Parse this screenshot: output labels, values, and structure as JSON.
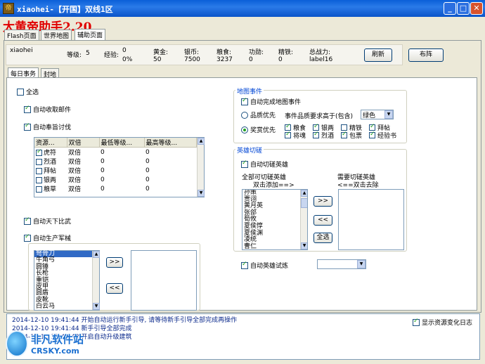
{
  "window": {
    "title": "xiaohei-【开国】双线1区",
    "icon": "app-icon"
  },
  "app_title": "大黄帝助手2.20",
  "tabs": [
    "Flash页面",
    "世界地图",
    "辅助页面"
  ],
  "info": {
    "player": "xiaohei",
    "level_label": "等级:",
    "level": "5",
    "exp_label": "经验:",
    "exp": "0",
    "exp_pct": "0%",
    "gold_label": "黄金:",
    "gold": "50",
    "silver_label": "银币:",
    "silver": "7500",
    "food_label": "粮食:",
    "food": "3237",
    "merit_label": "功勋:",
    "merit": "0",
    "iron_label": "精铁:",
    "iron": "0",
    "power_label": "总战力:",
    "power": "label16"
  },
  "buttons": {
    "refresh": "刷新",
    "formation": "布阵",
    "add": ">>",
    "remove": "<<",
    "select_all": "全选",
    "add2": ">>",
    "remove2": "<<"
  },
  "subtabs": [
    "每日事务",
    "封地"
  ],
  "checks": {
    "select_all": "全选",
    "auto_mail": "自动收取邮件",
    "auto_fengzhi": "自动奉旨讨伐",
    "auto_biwu": "自动天下比武",
    "auto_produce": "自动生产军械",
    "auto_map_event": "自动完成地图事件",
    "auto_hero": "自动切磋英雄",
    "auto_hero_trial": "自动英雄试炼",
    "show_log": "显示资源变化日志"
  },
  "resource_table": {
    "headers": [
      "资源...",
      "双倍",
      "最低等级...",
      "最高等级..."
    ],
    "rows": [
      [
        "虎符",
        "双倍",
        "0",
        "0"
      ],
      [
        "烈酒",
        "双倍",
        "0",
        "0"
      ],
      [
        "拜帖",
        "双倍",
        "0",
        "0"
      ],
      [
        "银两",
        "双倍",
        "0",
        "0"
      ],
      [
        "粮草",
        "双倍",
        "0",
        "0"
      ]
    ],
    "checked": [
      true,
      false,
      false,
      false,
      false
    ]
  },
  "weapons": [
    "弩骨刀",
    "牛角弓",
    "圆锤",
    "长枪",
    "重铠",
    "皮甲",
    "圆盾",
    "皮靴",
    "白云马"
  ],
  "map_event": {
    "group": "地图事件",
    "quality_first": "品质优先",
    "quality_req": "事件品质要求高于(包含)",
    "quality_value": "绿色",
    "reward_first": "奖赏优先",
    "rewards": [
      "粮食",
      "银两",
      "精铁",
      "拜帖",
      "将魂",
      "烈酒",
      "包票",
      "经验书"
    ],
    "rewards_checked": [
      true,
      true,
      false,
      true,
      true,
      true,
      true,
      true
    ]
  },
  "hero": {
    "group": "英雄切磋",
    "all_label": "全部可切磋英雄",
    "all_hint": "双击添加==>",
    "need_label": "需要切磋英雄",
    "need_hint": "<==双击去除",
    "list": [
      "孙策",
      "贾诩",
      "黄月英",
      "张郃",
      "荀攸",
      "夏侯惇",
      "夏侯渊",
      "凌统",
      "曹仁"
    ]
  },
  "log": [
    "2014-12-10 19:41:44 开始自动运行新手引导, 请等待新手引导全部完成再操作",
    "2014-12-10 19:41:44 新手引导全部完成",
    "2014-12-10 19:41:48 开启自动升级建筑"
  ],
  "watermark": {
    "name": "非凡软件站",
    "site": "CRSKY.com"
  },
  "colors": {
    "titlebar": "#0a5fd8",
    "brand": "#e00000",
    "accent": "#0046d5"
  }
}
